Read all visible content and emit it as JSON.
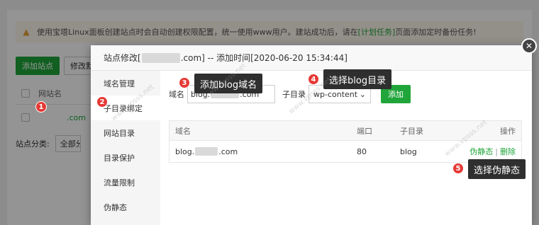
{
  "background": {
    "notice": {
      "text_before": "使用宝塔Linux面板创建站点时会自动创建权限配置，统一使用www用户。建站成功后，请在",
      "link": "[计划任务]",
      "text_after": "页面添加定时备份任务!"
    },
    "add_site_button": "添加站点",
    "modify_button": "修改默",
    "table_header": "网站名",
    "row_domain": ".com",
    "category_label": "站点分类:",
    "category_value": "全部分"
  },
  "dialog": {
    "title_prefix": "站点修改[",
    "title_suffix": ".com] -- 添加时间[2020-06-20 15:34:44]",
    "close_symbol": "✕",
    "sidebar": [
      {
        "label": "域名管理",
        "active": false
      },
      {
        "label": "子目录绑定",
        "active": true
      },
      {
        "label": "网站目录",
        "active": false
      },
      {
        "label": "目录保护",
        "active": false
      },
      {
        "label": "流量限制",
        "active": false
      },
      {
        "label": "伪静态",
        "active": false
      }
    ],
    "form": {
      "domain_label": "域名",
      "domain_value_prefix": "blog.",
      "domain_value_suffix": ".com",
      "subdir_label": "子目录",
      "subdir_value": "wp-content",
      "add_button": "添加"
    },
    "table": {
      "headers": [
        "域名",
        "端口",
        "子目录",
        "操作"
      ],
      "rows": [
        {
          "domain_prefix": "blog.",
          "domain_suffix": ".com",
          "port": "80",
          "subdir": "blog",
          "action_rewrite": "伪静态",
          "action_separator": "|",
          "action_delete": "删除"
        }
      ]
    }
  },
  "annotations": [
    {
      "num": "1"
    },
    {
      "num": "2"
    },
    {
      "num": "3",
      "text": "添加blog域名"
    },
    {
      "num": "4",
      "text": "选择blog目录"
    },
    {
      "num": "5",
      "text": "选择伪静态"
    }
  ],
  "watermark": "www.vpsss.net",
  "colors": {
    "accent": "#20a53a",
    "badge": "#e53935",
    "tooltip": "#2f2f2f"
  }
}
